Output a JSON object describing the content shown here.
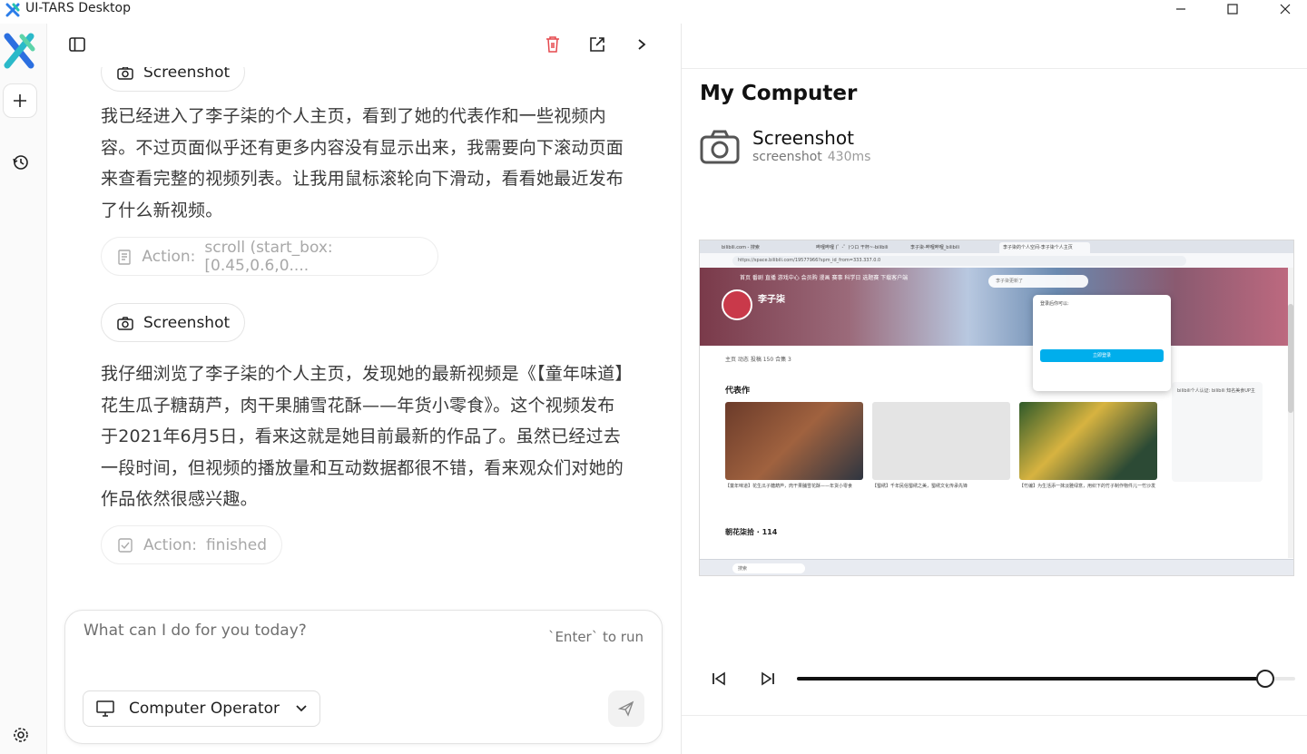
{
  "window": {
    "title": "UI-TARS Desktop"
  },
  "chat": {
    "screenshot_label_top": "Screenshot",
    "message_1": "我已经进入了李子柒的个人主页，看到了她的代表作和一些视频内容。不过页面似乎还有更多内容没有显示出来，我需要向下滚动页面来查看完整的视频列表。让我用鼠标滚轮向下滑动，看看她最近发布了什么新视频。",
    "action_1": {
      "label": "Action:",
      "value": "scroll (start_box: [0.45,0.6,0...."
    },
    "screenshot_label": "Screenshot",
    "message_2": "我仔细浏览了李子柒的个人主页，发现她的最新视频是《【童年味道】花生瓜子糖葫芦，肉干果脯雪花酥——年货小零食》。这个视频发布于2021年6月5日，看来这就是她目前最新的作品了。虽然已经过去一段时间，但视频的播放量和互动数据都很不错，看来观众们对她的作品依然很感兴趣。",
    "action_2": {
      "label": "Action:",
      "value": "finished"
    }
  },
  "composer": {
    "placeholder": "What can I do for you today?",
    "hint": "`Enter` to run",
    "operator": "Computer Operator"
  },
  "panel": {
    "title": "My Computer",
    "tool_name": "Screenshot",
    "tool_sub": "screenshot",
    "tool_time": "430ms",
    "playback_progress": 0.94
  },
  "mini": {
    "tabs": [
      "bilibili.com - 搜索",
      "哔哩哔哩 (゜-゜)つロ 干杯~-bilibili",
      "李子柒-哔哩哔哩_bilibili",
      "李子柒的个人空间-李子柒个人主页"
    ],
    "url": "https://space.bilibili.com/19577966?spm_id_from=333.337.0.0",
    "nav": "首页  番剧  直播  游戏中心  会员购  漫画  赛事  科学日  选题赛  下载客户端",
    "search": "李子柒更新了",
    "name": "李子柒",
    "tabs2": "主页    动态    投稿 150    合集 3",
    "section": "代表作",
    "section2": "朝花柒拾 · 114",
    "captions": [
      "【童年味道】花生瓜子糖葫芦，肉干果脯雪花酥——年货小零食",
      "【蜀绣】千年民俗蜀绣之美，蜀绣文化传承先锋",
      "【竹编】为生活添一抹淡雅绿意，用织下的竹子制作物件儿一竹沙发"
    ],
    "popup_title": "登录后你可以:",
    "popup_btn": "立即登录",
    "sidebar": "bilibili个人认证:  bilibili 知名美食UP主",
    "taskbar_search": "搜索"
  }
}
